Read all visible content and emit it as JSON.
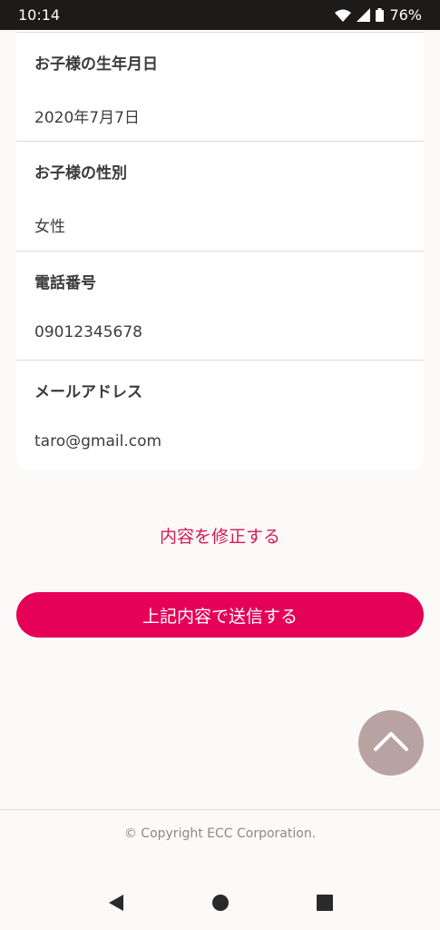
{
  "status_bar": {
    "time": "10:14",
    "battery": "76%"
  },
  "details": {
    "rows": [
      {
        "label": "お子様の生年月日",
        "value": "2020年7月7日"
      },
      {
        "label": "お子様の性別",
        "value": "女性"
      },
      {
        "label": "電話番号",
        "value": "09012345678"
      },
      {
        "label": "メールアドレス",
        "value": "taro@gmail.com"
      }
    ]
  },
  "actions": {
    "edit_label": "内容を修正する",
    "submit_label": "上記内容で送信する"
  },
  "footer": {
    "copyright": "© Copyright ECC Corporation."
  },
  "icons": {
    "scroll_top": "chevron-up-icon",
    "nav_back": "back-triangle-icon",
    "nav_home": "home-circle-icon",
    "nav_recents": "recents-square-icon"
  },
  "colors": {
    "accent": "#e50058",
    "link": "#d31a58",
    "scroll_button": "#b8a3a2"
  }
}
